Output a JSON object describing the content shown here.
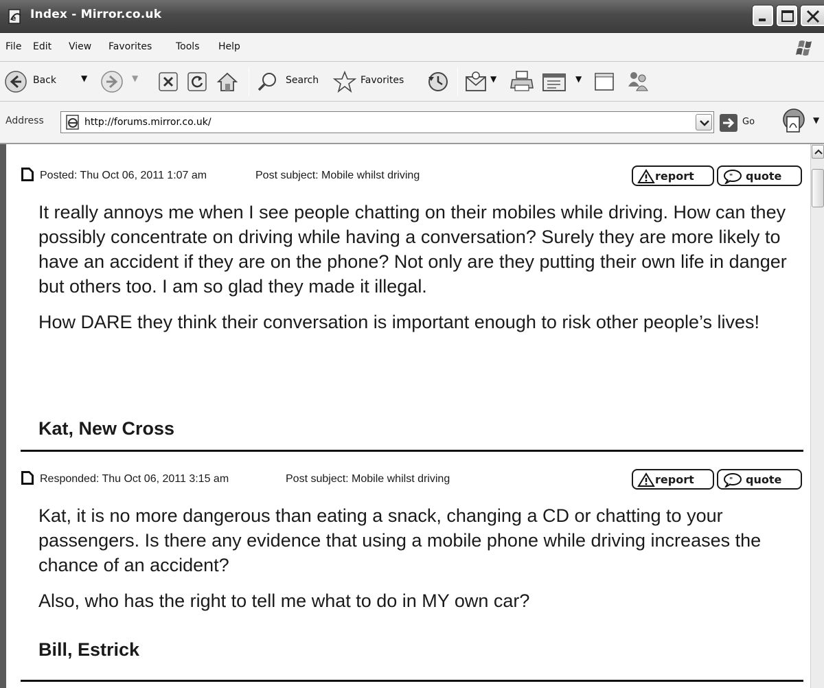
{
  "window": {
    "title": "Index - Mirror.co.uk"
  },
  "menubar": {
    "items": [
      "File",
      "Edit",
      "View",
      "Favorites",
      "Tools",
      "Help"
    ]
  },
  "toolbar": {
    "back_label": "Back",
    "search_label": "Search",
    "favorites_label": "Favorites"
  },
  "address": {
    "label": "Address",
    "url": "http://forums.mirror.co.uk/",
    "go_label": "Go"
  },
  "posts": [
    {
      "meta_date": "Posted: Thu Oct 06, 2011 1:07 am",
      "meta_subject": "Post subject: Mobile whilst driving",
      "report_label": "report",
      "quote_label": "quote",
      "paragraphs": [
        "It really annoys me when I see people chatting on their mobiles while driving. How can they possibly concentrate on driving while having a conversation? Surely they are more likely to have an accident if they are on the phone? Not only are they putting their own life in danger but others too. I am so glad they made it illegal.",
        "How DARE they think their conversation is important enough to risk other people’s lives!"
      ],
      "author": "Kat, New Cross"
    },
    {
      "meta_date": "Responded: Thu Oct 06, 2011 3:15 am",
      "meta_subject": "Post subject: Mobile whilst driving",
      "report_label": "report",
      "quote_label": "quote",
      "paragraphs": [
        "Kat, it is no more dangerous than eating a snack, changing a CD or chatting to your passengers. Is there any evidence that using a mobile phone while driving increases the chance of an accident?",
        "Also, who has the right to tell me what to do in MY own car?"
      ],
      "author": "Bill, Estrick"
    }
  ],
  "icons": {
    "title": "ie-page-icon",
    "back": "back-arrow-icon",
    "forward": "forward-arrow-icon",
    "stop": "stop-icon",
    "refresh": "refresh-icon",
    "home": "home-icon",
    "search": "search-icon",
    "favorites": "star-icon",
    "history": "history-icon",
    "mail": "mail-icon",
    "print": "print-icon",
    "edit": "edit-icon",
    "discuss": "discuss-icon",
    "messenger": "messenger-icon",
    "post": "document-icon"
  }
}
